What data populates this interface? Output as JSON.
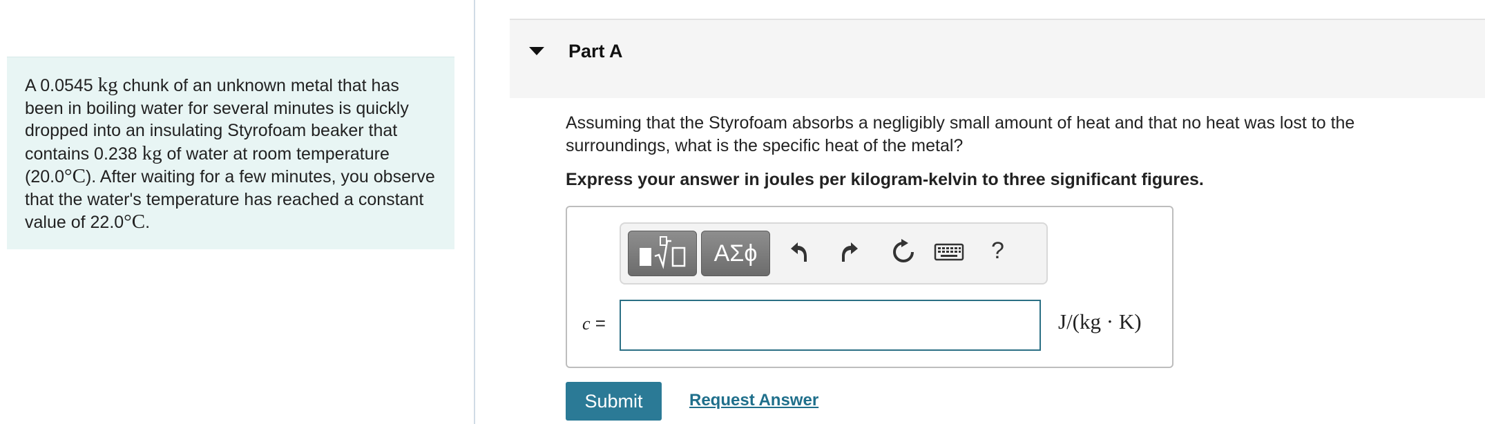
{
  "problem": {
    "seg1": "A 0.0545 ",
    "mass_unit": "kg",
    "seg2": " chunk of an unknown metal that has been in boiling water for several minutes is quickly dropped into an insulating Styrofoam beaker that contains 0.238 ",
    "mass_unit2": "kg",
    "seg3": " of water at room temperature (20.0",
    "temp_unit1": "°C",
    "seg4": "). After waiting for a few minutes, you observe that the water's temperature has reached a constant value of 22.0",
    "temp_unit2": "°C",
    "seg5": "."
  },
  "part": {
    "title": "Part A"
  },
  "question": {
    "text": "Assuming that the Styrofoam absorbs a negligibly small amount of heat and that no heat was lost to the surroundings, what is the specific heat of the metal?",
    "instruction": "Express your answer in joules per kilogram-kelvin to three significant figures."
  },
  "toolbar": {
    "greek_label": "ΑΣϕ",
    "help_label": "?"
  },
  "answer": {
    "variable": "c",
    "equals": " =",
    "value": "",
    "units": "J/(kg · K)"
  },
  "actions": {
    "submit_label": "Submit",
    "request_answer_label": "Request Answer"
  },
  "colors": {
    "panel_bg": "#e8f5f4",
    "submit_bg": "#2b7a96",
    "link": "#1f6f8b",
    "input_border": "#2a6f84"
  }
}
